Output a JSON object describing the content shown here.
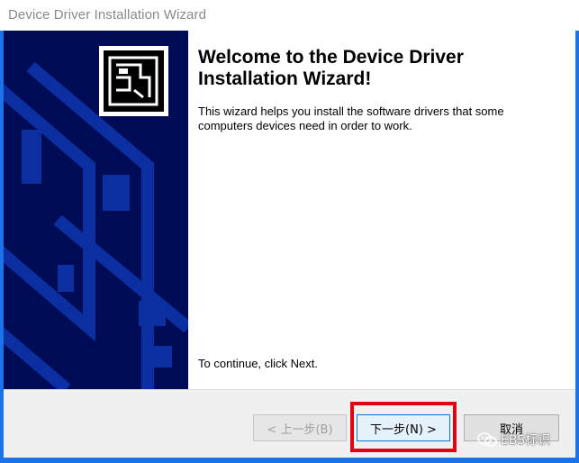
{
  "window": {
    "title": "Device Driver Installation Wizard"
  },
  "content": {
    "heading": "Welcome to the Device Driver Installation Wizard!",
    "description": "This wizard helps you install the software drivers that some computers devices need in order to work.",
    "continue_text": "To continue, click Next."
  },
  "buttons": {
    "back_label": "< 上一步(B)",
    "next_label": "下一步(N) >",
    "cancel_label": "取消"
  },
  "watermark": {
    "text": "EBS标识"
  },
  "colors": {
    "banner_bg": "#000b55",
    "banner_shape": "#0b2fa0",
    "frame": "#1a73e8",
    "highlight": "#e3000f"
  },
  "icons": {
    "banner_logo": "hardware-install-icon",
    "watermark_logo": "wechat-icon"
  }
}
